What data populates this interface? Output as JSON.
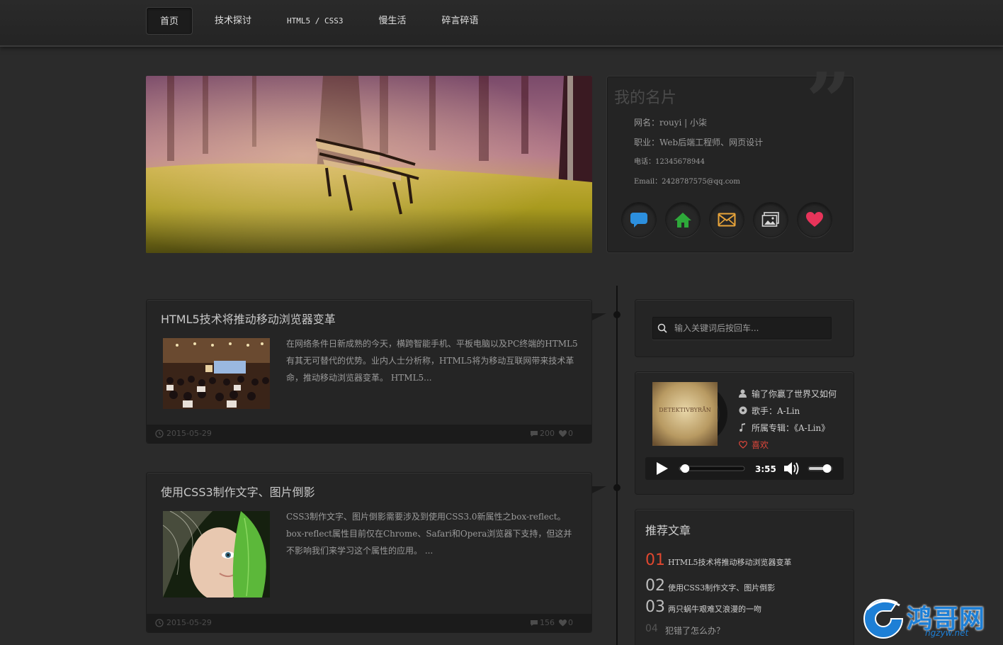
{
  "nav": {
    "items": [
      {
        "label": "首页",
        "active": true
      },
      {
        "label": "技术探讨",
        "active": false
      },
      {
        "label": "HTML5 / CSS3",
        "active": false
      },
      {
        "label": "慢生活",
        "active": false
      },
      {
        "label": "碎言碎语",
        "active": false
      }
    ]
  },
  "card": {
    "title": "我的名片",
    "lines": [
      "网名：rouyi | 小柒",
      "职业：Web后端工程师、网页设计",
      "电话：12345678944",
      "Email：2428787575@qq.com"
    ],
    "social_icons": [
      "chat-bubble-icon",
      "home-icon",
      "mail-icon",
      "gallery-icon",
      "heart-icon"
    ],
    "social_colors": [
      "#2c8fde",
      "#2ea83a",
      "#e8a43a",
      "#d8d8d8",
      "#e8345a"
    ]
  },
  "posts": [
    {
      "title": "HTML5技术将推动移动浏览器变革",
      "excerpt": "在网络条件日新成熟的今天，横跨智能手机、平板电脑以及PC终端的HTML5有其无可替代的优势。业内人士分析称，HTML5将为移动互联网带来技术革命，推动移动浏览器变革。 HTML5...",
      "date": "2015-05-29",
      "comments": "200",
      "likes": "0"
    },
    {
      "title": "使用CSS3制作文字、图片倒影",
      "excerpt": "CSS3制作文字、图片倒影需要涉及到使用CSS3.0新属性之box-reflect。box-reflect属性目前仅在Chrome、Safari和Opera浏览器下支持，但这并不影响我们来学习这个属性的应用。 ...",
      "date": "2015-05-29",
      "comments": "156",
      "likes": "0"
    }
  ],
  "search": {
    "placeholder": "输入关键词后按回车..."
  },
  "music": {
    "album_text": "DETEKTIVBYRÅN",
    "song": "输了你赢了世界又如何",
    "singer": "歌手：A-Lin",
    "album": "所属专辑：《A-Lin》",
    "like": "喜欢",
    "time": "3:55",
    "progress": 0.08,
    "volume": 0.8
  },
  "recommend": {
    "title": "推荐文章",
    "items": [
      {
        "num": "01",
        "text": "HTML5技术将推动移动浏览器变革"
      },
      {
        "num": "02",
        "text": "使用CSS3制作文字、图片倒影"
      },
      {
        "num": "03",
        "text": "两只蜗牛艰难又浪漫的一吻"
      },
      {
        "num": "04",
        "text": "犯错了怎么办？"
      }
    ]
  },
  "watermark": {
    "brand": "鸿哥网",
    "url": "hgzyw.net"
  }
}
